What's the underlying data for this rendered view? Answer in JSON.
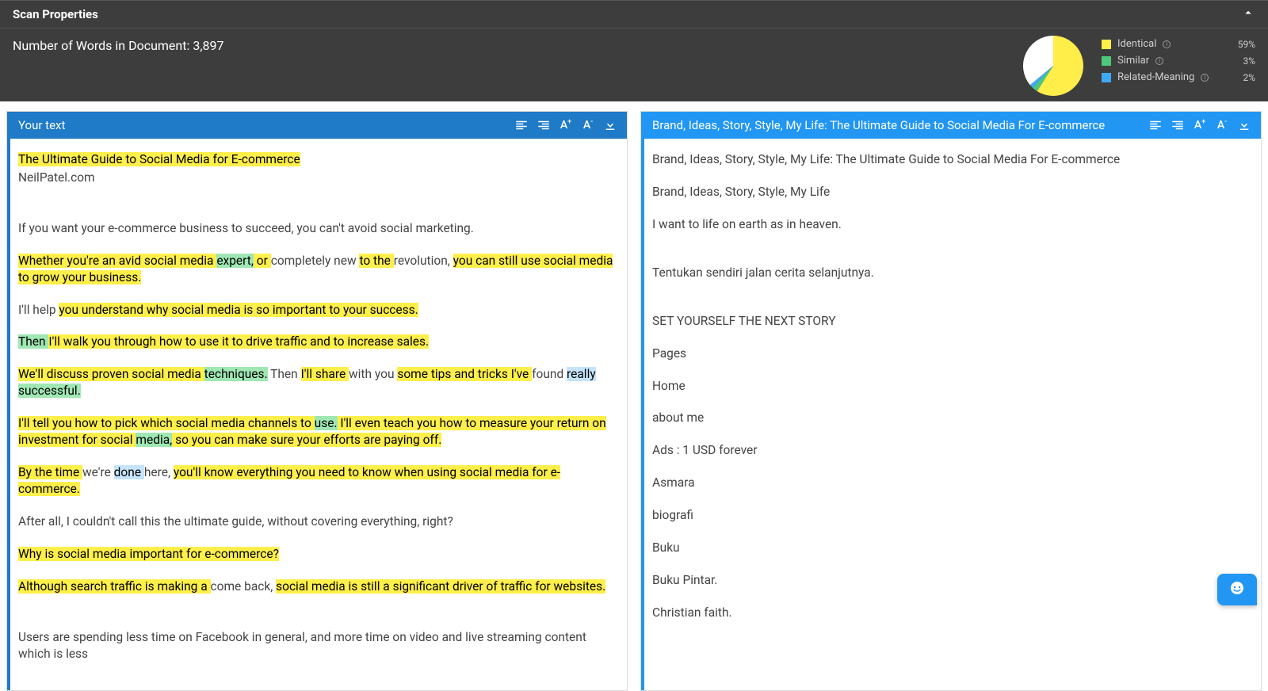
{
  "header": {
    "title": "Scan Properties",
    "words_label": "Number of Words in Document:",
    "words_value": "3,897",
    "legend": {
      "identical": {
        "label": "Identical",
        "pct": "59%"
      },
      "similar": {
        "label": "Similar",
        "pct": "3%"
      },
      "related": {
        "label": "Related-Meaning",
        "pct": "2%"
      }
    }
  },
  "chart_data": {
    "type": "pie",
    "title": "Match composition",
    "categories": [
      "Identical",
      "Similar",
      "Related-Meaning",
      "Unmatched"
    ],
    "values": [
      59,
      3,
      2,
      36
    ],
    "colors": {
      "Identical": "#ffed4a",
      "Similar": "#4ec77b",
      "Related-Meaning": "#3fa9f5",
      "Unmatched": "#ffffff"
    }
  },
  "left_panel": {
    "title": "Your text",
    "s1": "The Ultimate Guide to Social Media for E-commerce",
    "s2": "NeilPatel.com",
    "s3": "If you want your e-commerce business to succeed, you can't avoid social marketing.",
    "p4": {
      "a": "Whether you're an avid social media ",
      "b": "expert,",
      "c": " or ",
      "d": "completely new ",
      "e": "to the ",
      "f": "revolution, ",
      "g": "you can still use social media to grow your business."
    },
    "p5": {
      "a": "I'll help ",
      "b": "you understand why social media is so important to your success."
    },
    "p6": {
      "a": "Then ",
      "b": "I'll walk you through how to use it to drive traffic and to increase sales."
    },
    "p7": {
      "a": "We'll discuss proven social media ",
      "b": "techniques.",
      "c": " Then ",
      "d": "I'll share ",
      "e": "with you ",
      "f": "some tips and tricks ",
      "g": "I've ",
      "h": "found ",
      "i": "really ",
      "j": "successful."
    },
    "p8": {
      "a": "I'll tell you how to pick which social media channels to ",
      "b": "use.",
      "c": " I'll even teach you how to measure your return on investment for social ",
      "d": "media,",
      "e": " so you can make sure your efforts are paying off."
    },
    "p9": {
      "a": "By the time ",
      "b": "we're ",
      "c": "done ",
      "d": "here, ",
      "e": "you'll know everything you need to know when using social media for e-commerce."
    },
    "s10": "After all, I couldn't call this the ultimate guide, without covering everything, right?",
    "s11": "Why is social media important for e-commerce?",
    "p12": {
      "a": "Although search traffic is making a ",
      "b": "come back, ",
      "c": "social media is still a significant driver of traffic for websites."
    },
    "s13": "Users are spending less time on Facebook in general, and more time on video and live streaming content which is less"
  },
  "right_panel": {
    "title": "Brand, Ideas, Story, Style, My Life: The Ultimate Guide to Social Media For E-commerce",
    "lines": [
      "Brand, Ideas, Story, Style, My Life: The Ultimate Guide to Social Media For E-commerce",
      "Brand, Ideas, Story, Style, My Life",
      "I want to life on earth as in heaven.",
      "Tentukan sendiri jalan cerita selanjutnya.",
      "SET YOURSELF THE NEXT STORY",
      "Pages",
      "Home",
      "about me",
      "Ads : 1 USD forever",
      "Asmara",
      "biografi",
      "Buku",
      "Buku Pintar.",
      "Christian faith."
    ]
  }
}
